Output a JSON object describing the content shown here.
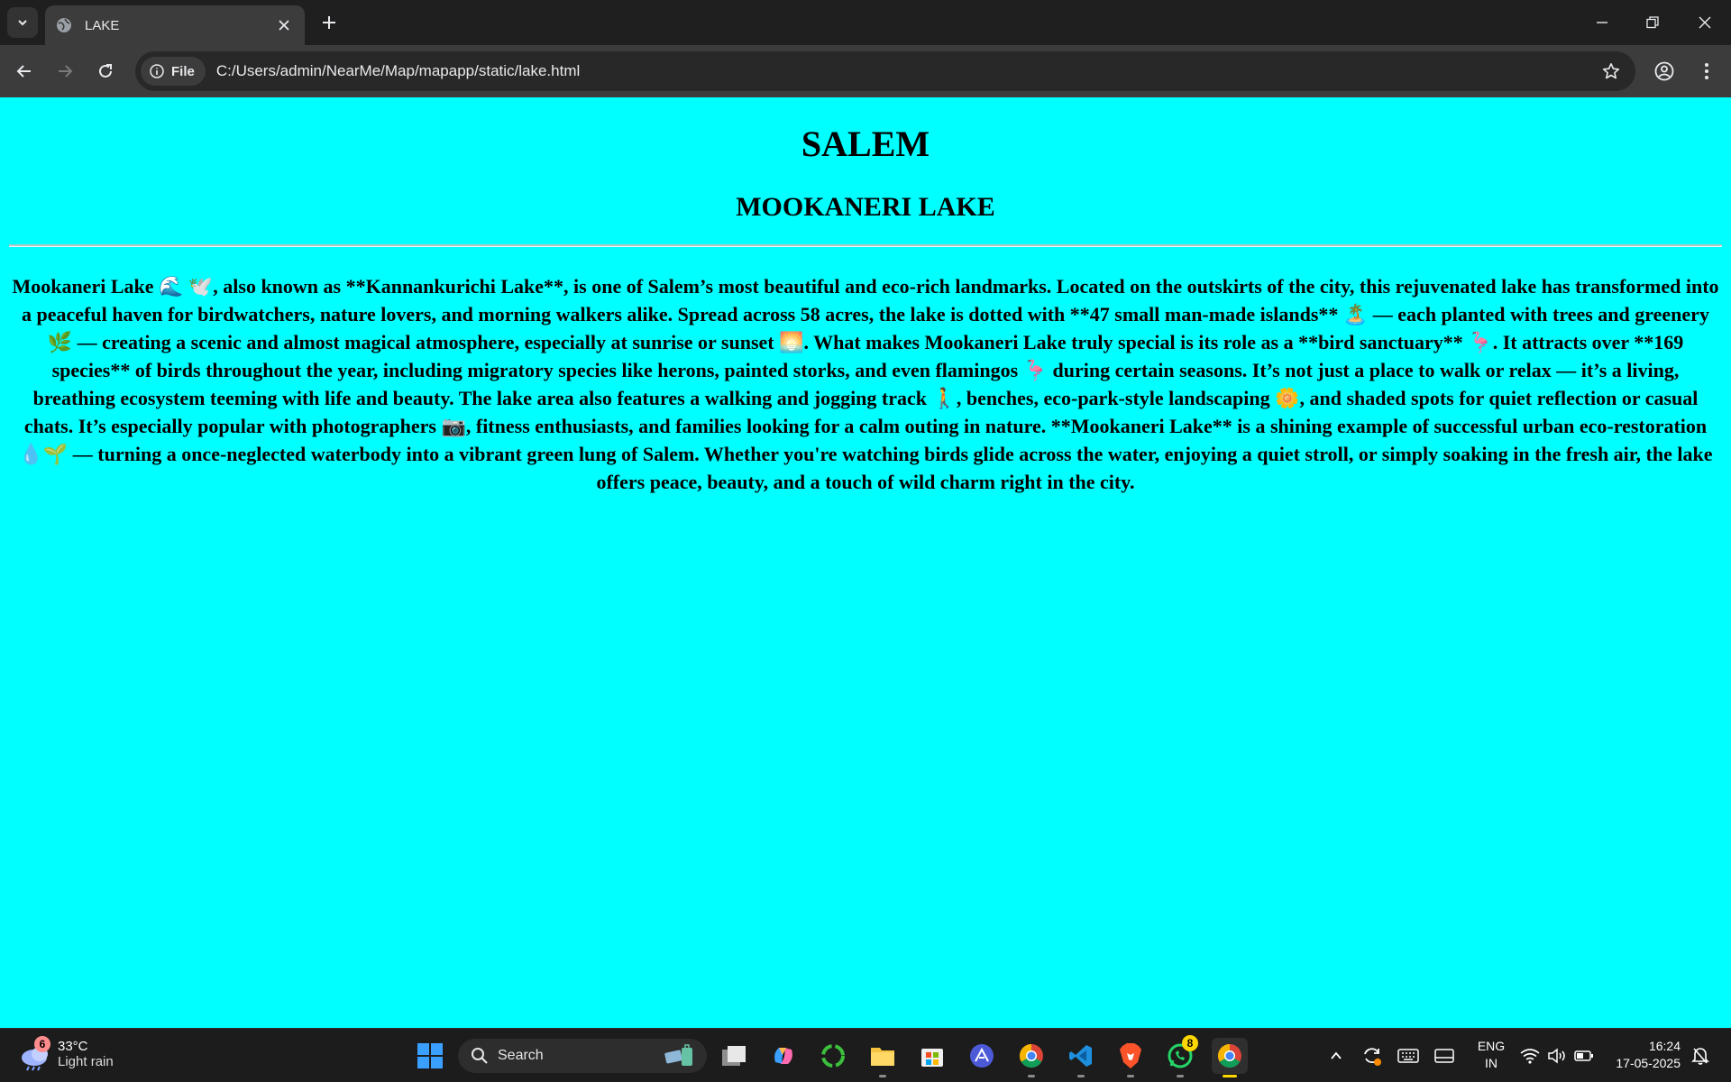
{
  "browser": {
    "tab": {
      "title": "LAKE"
    },
    "omnibox": {
      "chip_label": "File",
      "url": "C:/Users/admin/NearMe/Map/mapapp/static/lake.html"
    }
  },
  "page": {
    "title": "SALEM",
    "subtitle": "MOOKANERI LAKE",
    "paragraph": "Mookaneri Lake 🌊 🕊️, also known as **Kannankurichi Lake**, is one of Salem’s most beautiful and eco-rich landmarks. Located on the outskirts of the city, this rejuvenated lake has transformed into a peaceful haven for birdwatchers, nature lovers, and morning walkers alike. Spread across 58 acres, the lake is dotted with **47 small man-made islands** 🏝️ — each planted with trees and greenery 🌿 — creating a scenic and almost magical atmosphere, especially at sunrise or sunset 🌅. What makes Mookaneri Lake truly special is its role as a **bird sanctuary** 🦩. It attracts over **169 species** of birds throughout the year, including migratory species like herons, painted storks, and even flamingos 🦩 during certain seasons. It’s not just a place to walk or relax — it’s a living, breathing ecosystem teeming with life and beauty. The lake area also features a walking and jogging track 🚶, benches, eco-park-style landscaping 🌼, and shaded spots for quiet reflection or casual chats. It’s especially popular with photographers 📷, fitness enthusiasts, and families looking for a calm outing in nature. **Mookaneri Lake** is a shining example of successful urban eco-restoration 💧🌱 — turning a once-neglected waterbody into a vibrant green lung of Salem. Whether you're watching birds glide across the water, enjoying a quiet stroll, or simply soaking in the fresh air, the lake offers peace, beauty, and a touch of wild charm right in the city.",
    "background_color": "#00ffff"
  },
  "taskbar": {
    "weather": {
      "temp": "33°C",
      "condition": "Light rain",
      "badge": "6"
    },
    "search_label": "Search",
    "whatsapp_badge": "8",
    "language": {
      "line1": "ENG",
      "line2": "IN"
    },
    "clock": {
      "time": "16:24",
      "date": "17-05-2025"
    },
    "apps": [
      "start-icon",
      "task-view-icon",
      "copilot-icon",
      "circle-app-icon",
      "file-explorer-icon",
      "store-icon",
      "triangle-app-icon",
      "chrome-icon",
      "vscode-icon",
      "brave-icon",
      "whatsapp-icon",
      "chrome-active-icon"
    ]
  }
}
